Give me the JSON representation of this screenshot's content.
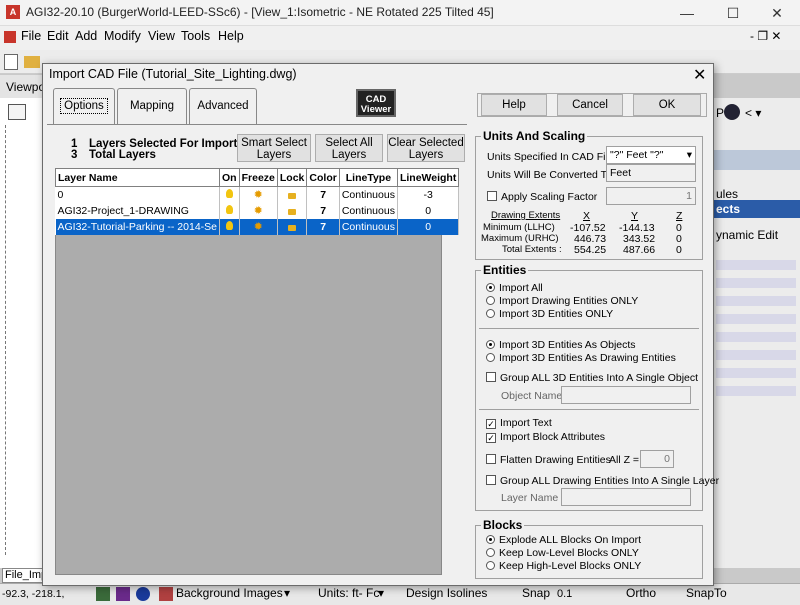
{
  "window": {
    "app_icon": "A",
    "title": "AGI32-20.10 (BurgerWorld-LEED-SSc6) - [View_1:Isometric - NE Rotated 225 Tilted 45]",
    "minimize": "—",
    "maximize": "☐",
    "close": "✕"
  },
  "menu": {
    "items": [
      "File",
      "Edit",
      "Add",
      "Modify",
      "View",
      "Tools",
      "Help"
    ],
    "right": "- ❐ ✕"
  },
  "viewport_tab": "Viewpo",
  "left_pane": {
    "file_tab": "File_Imp",
    "coords": "-92.3, -218.1,"
  },
  "right_pane": {
    "labels": [
      "P",
      "ules",
      "ects",
      "ynamic Edit"
    ],
    "selected_label": "ects"
  },
  "statusbar": {
    "background_images": "Background Images",
    "units": "Units: ft- Fc",
    "design_isolines": "Design Isolines",
    "snap": "Snap",
    "snap_value": "0.1",
    "ortho": "Ortho",
    "snapto": "SnapTo"
  },
  "dialog": {
    "title": "Import CAD File (Tutorial_Site_Lighting.dwg)",
    "close": "✕",
    "tabs": [
      "Options",
      "Mapping",
      "Advanced"
    ],
    "active_tab": "Options",
    "cad_viewer": "CAD Viewer",
    "buttons": {
      "help": "Help",
      "cancel": "Cancel",
      "ok": "OK"
    },
    "selection": {
      "selected_count": "1",
      "selected_label": "Layers Selected For Import",
      "total_count": "3",
      "total_label": "Total Layers"
    },
    "smart_select": "Smart Select Layers",
    "select_all": "Select All Layers",
    "clear_selected": "Clear Selected Layers",
    "table": {
      "headers": [
        "Layer Name",
        "On",
        "Freeze",
        "Lock",
        "Color",
        "LineType",
        "LineWeight"
      ],
      "rows": [
        {
          "name": "0",
          "color": "7",
          "linetype": "Continuous",
          "lineweight": "-3",
          "selected": false
        },
        {
          "name": "AGI32-Project_1-DRAWING",
          "color": "7",
          "linetype": "Continuous",
          "lineweight": "0",
          "selected": false
        },
        {
          "name": "AGI32-Tutorial-Parking -- 2014-Se",
          "color": "7",
          "linetype": "Continuous",
          "lineweight": "0",
          "selected": true
        }
      ]
    },
    "units": {
      "title": "Units And Scaling",
      "specified_label": "Units Specified In CAD File",
      "specified_value": "\"?\" Feet \"?\"",
      "converted_label": "Units Will Be Converted To",
      "converted_value": "Feet",
      "apply_scaling": "Apply Scaling Factor",
      "scaling_value": "1",
      "extents": {
        "heading": "Drawing Extents",
        "cols": [
          "X",
          "Y",
          "Z"
        ],
        "rows": [
          {
            "label": "Minimum  (LLHC)",
            "x": "-107.52",
            "y": "-144.13",
            "z": "0"
          },
          {
            "label": "Maximum  (URHC)",
            "x": "446.73",
            "y": "343.52",
            "z": "0"
          },
          {
            "label": "Total Extents :",
            "x": "554.25",
            "y": "487.66",
            "z": "0"
          }
        ]
      }
    },
    "entities": {
      "title": "Entities",
      "import_all": "Import All",
      "import_drawing_only": "Import Drawing Entities ONLY",
      "import_3d_only": "Import 3D Entities ONLY",
      "import_3d_objects": "Import 3D Entities As Objects",
      "import_3d_drawing": "Import 3D Entities As Drawing Entities",
      "group_3d": "Group ALL 3D Entities Into A Single Object",
      "object_name": "Object Name",
      "import_text": "Import Text",
      "import_block_attrs": "Import Block Attributes",
      "flatten": "Flatten Drawing Entities",
      "all_z": "All Z =",
      "all_z_value": "0",
      "group_drawing": "Group ALL Drawing Entities Into A Single Layer",
      "layer_name": "Layer Name"
    },
    "blocks": {
      "title": "Blocks",
      "explode": "Explode ALL Blocks On Import",
      "keep_low": "Keep Low-Level Blocks ONLY",
      "keep_high": "Keep High-Level Blocks ONLY"
    }
  }
}
